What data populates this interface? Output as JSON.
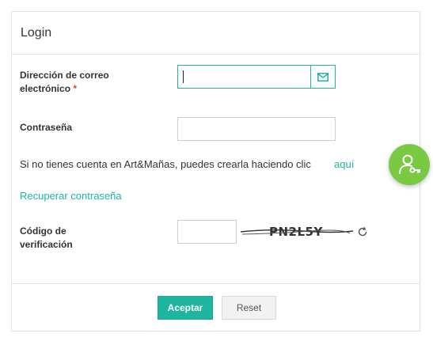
{
  "form": {
    "title": "Login",
    "email": {
      "label_line1": "Dirección de correo",
      "label_line2": "electrónico",
      "required_mark": "*",
      "value": "",
      "icon": "envelope-icon"
    },
    "password": {
      "label": "Contraseña",
      "value": ""
    },
    "register_prompt": "Si no tienes cuenta en Art&Mañas, puedes crearla haciendo clic",
    "register_link": "aquí",
    "recover_link": "Recuperar contraseña",
    "captcha": {
      "label_line1": "Código de",
      "label_line2": "verificación",
      "value": "",
      "code": "PN2L5Y",
      "refresh_icon": "refresh-icon"
    },
    "buttons": {
      "submit": "Aceptar",
      "reset": "Reset"
    }
  },
  "colors": {
    "accent": "#1fb5a0",
    "required": "#e53935",
    "fab": "#7ac943",
    "border": "#e3e3e3"
  },
  "fab": {
    "icon": "user-key-icon"
  }
}
